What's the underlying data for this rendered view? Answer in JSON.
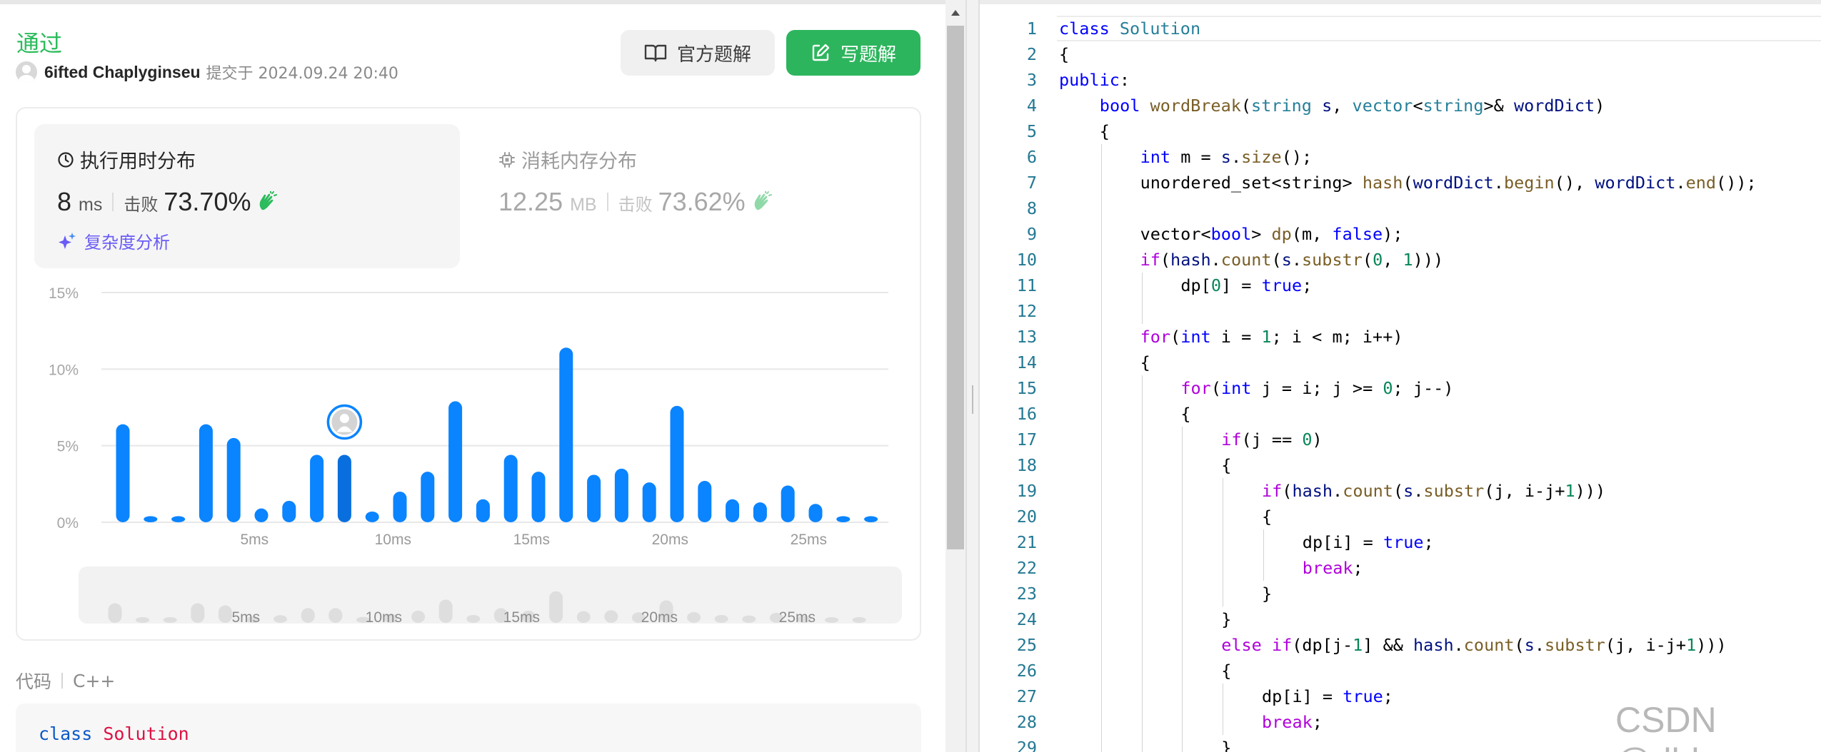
{
  "submission": {
    "status": "通过",
    "user": "6ifted Chaplyginseu",
    "submitted_text": "提交于 2024.09.24 20:40"
  },
  "buttons": {
    "official_solution": "官方题解",
    "write_solution": "写题解"
  },
  "runtime": {
    "title": "执行用时分布",
    "value": "8",
    "unit": "ms",
    "beat_label": "击败",
    "beat_pct": "73.70%",
    "analysis_label": "复杂度分析"
  },
  "memory": {
    "title": "消耗内存分布",
    "value": "12.25",
    "unit": "MB",
    "beat_label": "击败",
    "beat_pct": "73.62%"
  },
  "colors": {
    "accent_green": "#2cbb5d",
    "bar_blue": "#0a84ff",
    "bar_highlight": "#0a6fde",
    "purple": "#6a5cf6"
  },
  "chart_data": {
    "type": "bar",
    "xlabel": "",
    "ylabel": "",
    "ylim": [
      0,
      15
    ],
    "y_ticks": [
      "0%",
      "5%",
      "10%",
      "15%"
    ],
    "y_tick_values": [
      0,
      5,
      10,
      15
    ],
    "x_tick_labels": [
      "5ms",
      "10ms",
      "15ms",
      "20ms",
      "25ms"
    ],
    "x_tick_bins": [
      5,
      10,
      15,
      20,
      25
    ],
    "bins": [
      1,
      2,
      3,
      4,
      5,
      6,
      7,
      8,
      9,
      10,
      11,
      12,
      13,
      14,
      15,
      16,
      17,
      18,
      19,
      20,
      21,
      22,
      23,
      24,
      25,
      26,
      27
    ],
    "values": [
      6.4,
      0.4,
      0.4,
      6.4,
      5.5,
      0.9,
      1.4,
      4.4,
      4.4,
      0.7,
      2.0,
      3.3,
      7.9,
      1.5,
      4.4,
      3.3,
      11.4,
      3.1,
      3.5,
      2.6,
      7.6,
      2.7,
      1.5,
      1.3,
      2.4,
      1.2,
      0.4,
      0.4
    ],
    "grid": true,
    "highlight_bin": 8,
    "overview_x_tick_labels": [
      "5ms",
      "10ms",
      "15ms",
      "20ms",
      "25ms"
    ]
  },
  "code_section": {
    "label": "代码",
    "language": "C++",
    "preview_keyword": "class",
    "preview_name": "Solution"
  },
  "editor": {
    "lines": [
      {
        "no": "1",
        "indent": 0,
        "tokens": [
          [
            "k",
            "class"
          ],
          [
            "",
            " "
          ],
          [
            "t",
            "Solution"
          ]
        ]
      },
      {
        "no": "2",
        "indent": 0,
        "tokens": [
          [
            "",
            "{"
          ]
        ]
      },
      {
        "no": "3",
        "indent": 0,
        "tokens": [
          [
            "k",
            "public"
          ],
          [
            "",
            ":"
          ]
        ]
      },
      {
        "no": "4",
        "indent": 1,
        "tokens": [
          [
            "k",
            "bool"
          ],
          [
            "",
            " "
          ],
          [
            "f",
            "wordBreak"
          ],
          [
            "",
            "("
          ],
          [
            "t",
            "string"
          ],
          [
            "",
            " "
          ],
          [
            "v",
            "s"
          ],
          [
            "",
            ", "
          ],
          [
            "t",
            "vector"
          ],
          [
            "",
            "<"
          ],
          [
            "t",
            "string"
          ],
          [
            "",
            ">& "
          ],
          [
            "v",
            "wordDict"
          ],
          [
            "",
            ")"
          ]
        ]
      },
      {
        "no": "5",
        "indent": 1,
        "tokens": [
          [
            "",
            "{"
          ]
        ]
      },
      {
        "no": "6",
        "indent": 2,
        "tokens": [
          [
            "k",
            "int"
          ],
          [
            "",
            " m = "
          ],
          [
            "v",
            "s"
          ],
          [
            "",
            "."
          ],
          [
            "f",
            "size"
          ],
          [
            "",
            "();"
          ]
        ]
      },
      {
        "no": "7",
        "indent": 2,
        "tokens": [
          [
            "",
            "unordered_set<string> "
          ],
          [
            "f",
            "hash"
          ],
          [
            "",
            "("
          ],
          [
            "v",
            "wordDict"
          ],
          [
            "",
            "."
          ],
          [
            "f",
            "begin"
          ],
          [
            "",
            "(), "
          ],
          [
            "v",
            "wordDict"
          ],
          [
            "",
            "."
          ],
          [
            "f",
            "end"
          ],
          [
            "",
            "());"
          ]
        ]
      },
      {
        "no": "8",
        "indent": 2,
        "tokens": []
      },
      {
        "no": "9",
        "indent": 2,
        "tokens": [
          [
            "",
            "vector<"
          ],
          [
            "k",
            "bool"
          ],
          [
            "",
            "> "
          ],
          [
            "f",
            "dp"
          ],
          [
            "",
            "(m, "
          ],
          [
            "k",
            "false"
          ],
          [
            "",
            ");"
          ]
        ]
      },
      {
        "no": "10",
        "indent": 2,
        "tokens": [
          [
            "kc",
            "if"
          ],
          [
            "",
            "("
          ],
          [
            "v",
            "hash"
          ],
          [
            "",
            "."
          ],
          [
            "f",
            "count"
          ],
          [
            "",
            "("
          ],
          [
            "v",
            "s"
          ],
          [
            "",
            "."
          ],
          [
            "f",
            "substr"
          ],
          [
            "",
            "("
          ],
          [
            "n",
            "0"
          ],
          [
            "",
            ", "
          ],
          [
            "n",
            "1"
          ],
          [
            "",
            ")))"
          ]
        ]
      },
      {
        "no": "11",
        "indent": 3,
        "tokens": [
          [
            "",
            "dp["
          ],
          [
            "n",
            "0"
          ],
          [
            "",
            "] = "
          ],
          [
            "k",
            "true"
          ],
          [
            "",
            ";"
          ]
        ]
      },
      {
        "no": "12",
        "indent": 2,
        "tokens": []
      },
      {
        "no": "13",
        "indent": 2,
        "tokens": [
          [
            "kc",
            "for"
          ],
          [
            "",
            "("
          ],
          [
            "k",
            "int"
          ],
          [
            "",
            " i = "
          ],
          [
            "n",
            "1"
          ],
          [
            "",
            "; i < m; i++)"
          ]
        ]
      },
      {
        "no": "14",
        "indent": 2,
        "tokens": [
          [
            "",
            "{"
          ]
        ]
      },
      {
        "no": "15",
        "indent": 3,
        "tokens": [
          [
            "kc",
            "for"
          ],
          [
            "",
            "("
          ],
          [
            "k",
            "int"
          ],
          [
            "",
            " j = i; j >= "
          ],
          [
            "n",
            "0"
          ],
          [
            "",
            "; j--)"
          ]
        ]
      },
      {
        "no": "16",
        "indent": 3,
        "tokens": [
          [
            "",
            "{"
          ]
        ]
      },
      {
        "no": "17",
        "indent": 4,
        "tokens": [
          [
            "kc",
            "if"
          ],
          [
            "",
            "(j == "
          ],
          [
            "n",
            "0"
          ],
          [
            "",
            ")"
          ]
        ]
      },
      {
        "no": "18",
        "indent": 4,
        "tokens": [
          [
            "",
            "{"
          ]
        ]
      },
      {
        "no": "19",
        "indent": 5,
        "tokens": [
          [
            "kc",
            "if"
          ],
          [
            "",
            "("
          ],
          [
            "v",
            "hash"
          ],
          [
            "",
            "."
          ],
          [
            "f",
            "count"
          ],
          [
            "",
            "("
          ],
          [
            "v",
            "s"
          ],
          [
            "",
            "."
          ],
          [
            "f",
            "substr"
          ],
          [
            "",
            "(j, i-j+"
          ],
          [
            "n",
            "1"
          ],
          [
            "",
            ")))"
          ]
        ]
      },
      {
        "no": "20",
        "indent": 5,
        "tokens": [
          [
            "",
            "{"
          ]
        ]
      },
      {
        "no": "21",
        "indent": 6,
        "tokens": [
          [
            "",
            "dp[i] = "
          ],
          [
            "k",
            "true"
          ],
          [
            "",
            ";"
          ]
        ]
      },
      {
        "no": "22",
        "indent": 6,
        "tokens": [
          [
            "kc",
            "break"
          ],
          [
            "",
            ";"
          ]
        ]
      },
      {
        "no": "23",
        "indent": 5,
        "tokens": [
          [
            "",
            "}"
          ]
        ]
      },
      {
        "no": "24",
        "indent": 4,
        "tokens": [
          [
            "",
            "}"
          ]
        ]
      },
      {
        "no": "25",
        "indent": 4,
        "tokens": [
          [
            "kc",
            "else"
          ],
          [
            "",
            " "
          ],
          [
            "kc",
            "if"
          ],
          [
            "",
            "(dp[j-"
          ],
          [
            "n",
            "1"
          ],
          [
            "",
            "] && "
          ],
          [
            "v",
            "hash"
          ],
          [
            "",
            "."
          ],
          [
            "f",
            "count"
          ],
          [
            "",
            "("
          ],
          [
            "v",
            "s"
          ],
          [
            "",
            "."
          ],
          [
            "f",
            "substr"
          ],
          [
            "",
            "(j, i-j+"
          ],
          [
            "n",
            "1"
          ],
          [
            "",
            ")))"
          ]
        ]
      },
      {
        "no": "26",
        "indent": 4,
        "tokens": [
          [
            "",
            "{"
          ]
        ]
      },
      {
        "no": "27",
        "indent": 5,
        "tokens": [
          [
            "",
            "dp[i] = "
          ],
          [
            "k",
            "true"
          ],
          [
            "",
            ";"
          ]
        ]
      },
      {
        "no": "28",
        "indent": 5,
        "tokens": [
          [
            "kc",
            "break"
          ],
          [
            "",
            ";"
          ]
        ]
      },
      {
        "no": "29",
        "indent": 4,
        "tokens": [
          [
            "",
            "}"
          ]
        ]
      }
    ]
  },
  "watermark": "CSDN @dbln"
}
